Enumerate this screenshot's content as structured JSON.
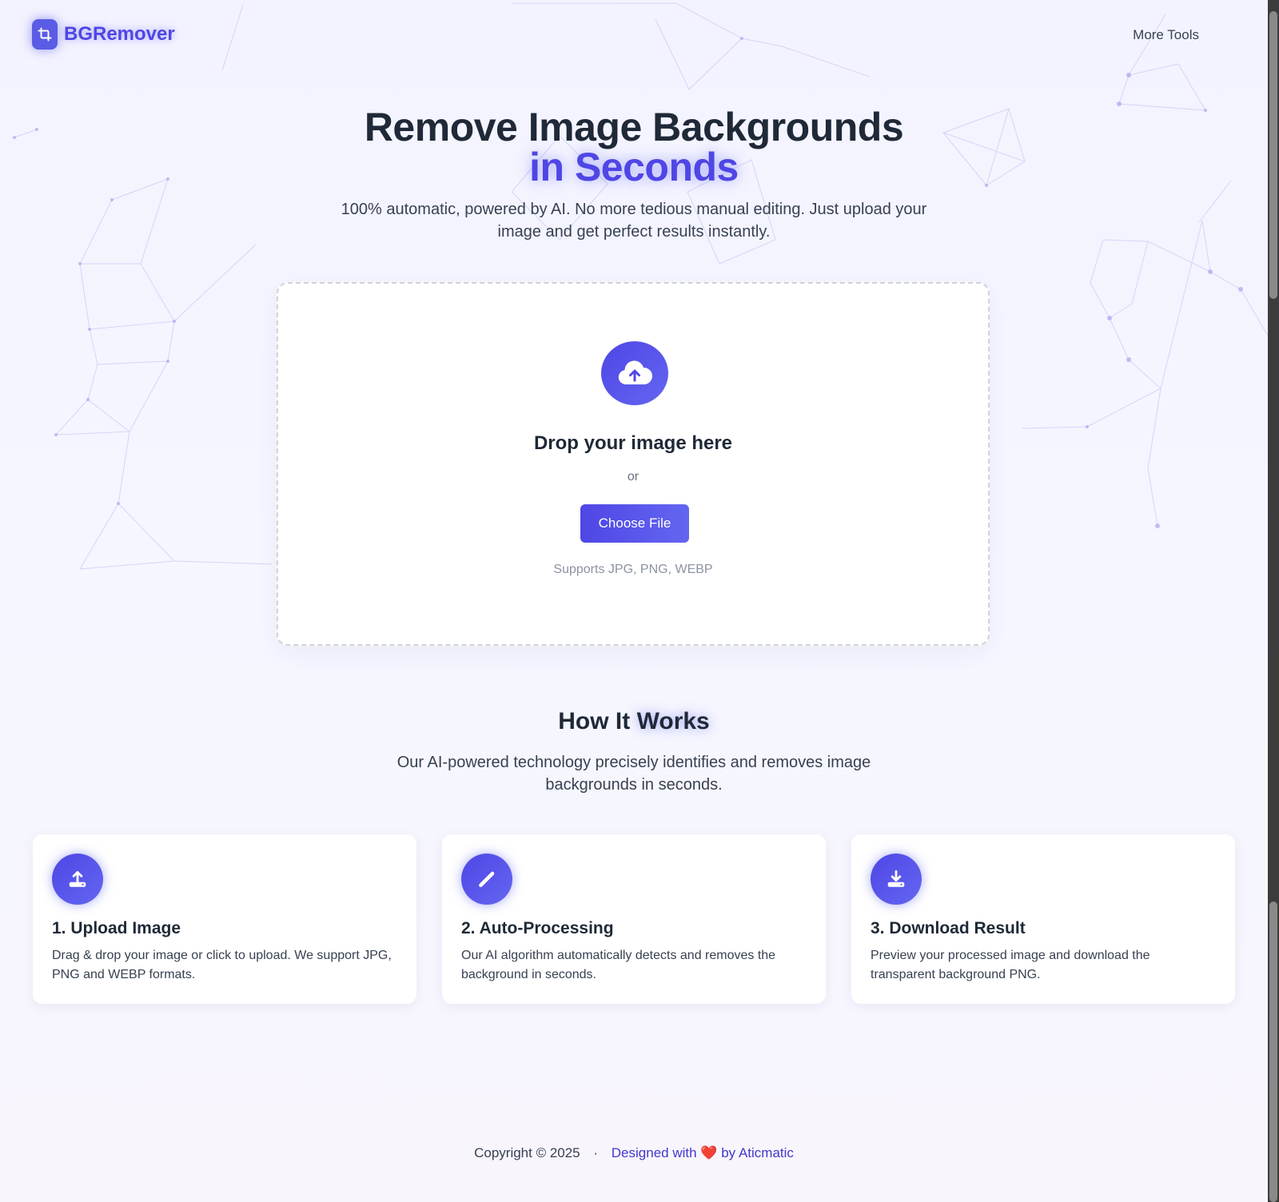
{
  "brand": {
    "name": "BGRemover",
    "icon": "crop-icon",
    "accent": "#4f46e5"
  },
  "nav": {
    "more_tools": "More Tools"
  },
  "hero": {
    "title_line1": "Remove Image Backgrounds",
    "title_line2": "in Seconds",
    "subtitle": "100% automatic, powered by AI. No more tedious manual editing. Just upload your image and get perfect results instantly."
  },
  "dropzone": {
    "icon": "cloud-upload-icon",
    "title": "Drop your image here",
    "or": "or",
    "button": "Choose File",
    "note": "Supports JPG, PNG, WEBP"
  },
  "how": {
    "title_part1": "How It",
    "title_part2": "Works",
    "subtitle": "Our AI-powered technology precisely identifies and removes image backgrounds in seconds.",
    "steps": [
      {
        "icon": "upload-icon",
        "title": "1. Upload Image",
        "desc": "Drag & drop your image or click to upload. We support JPG, PNG and WEBP formats."
      },
      {
        "icon": "magic-wand-icon",
        "title": "2. Auto-Processing",
        "desc": "Our AI algorithm automatically detects and removes the background in seconds."
      },
      {
        "icon": "download-icon",
        "title": "3. Download Result",
        "desc": "Preview your processed image and download the transparent background PNG."
      }
    ]
  },
  "footer": {
    "copyright": "Copyright © 2025",
    "separator": "·",
    "designed_prefix": "Designed with",
    "heart": "❤️",
    "designed_suffix": "by Aticmatic"
  }
}
